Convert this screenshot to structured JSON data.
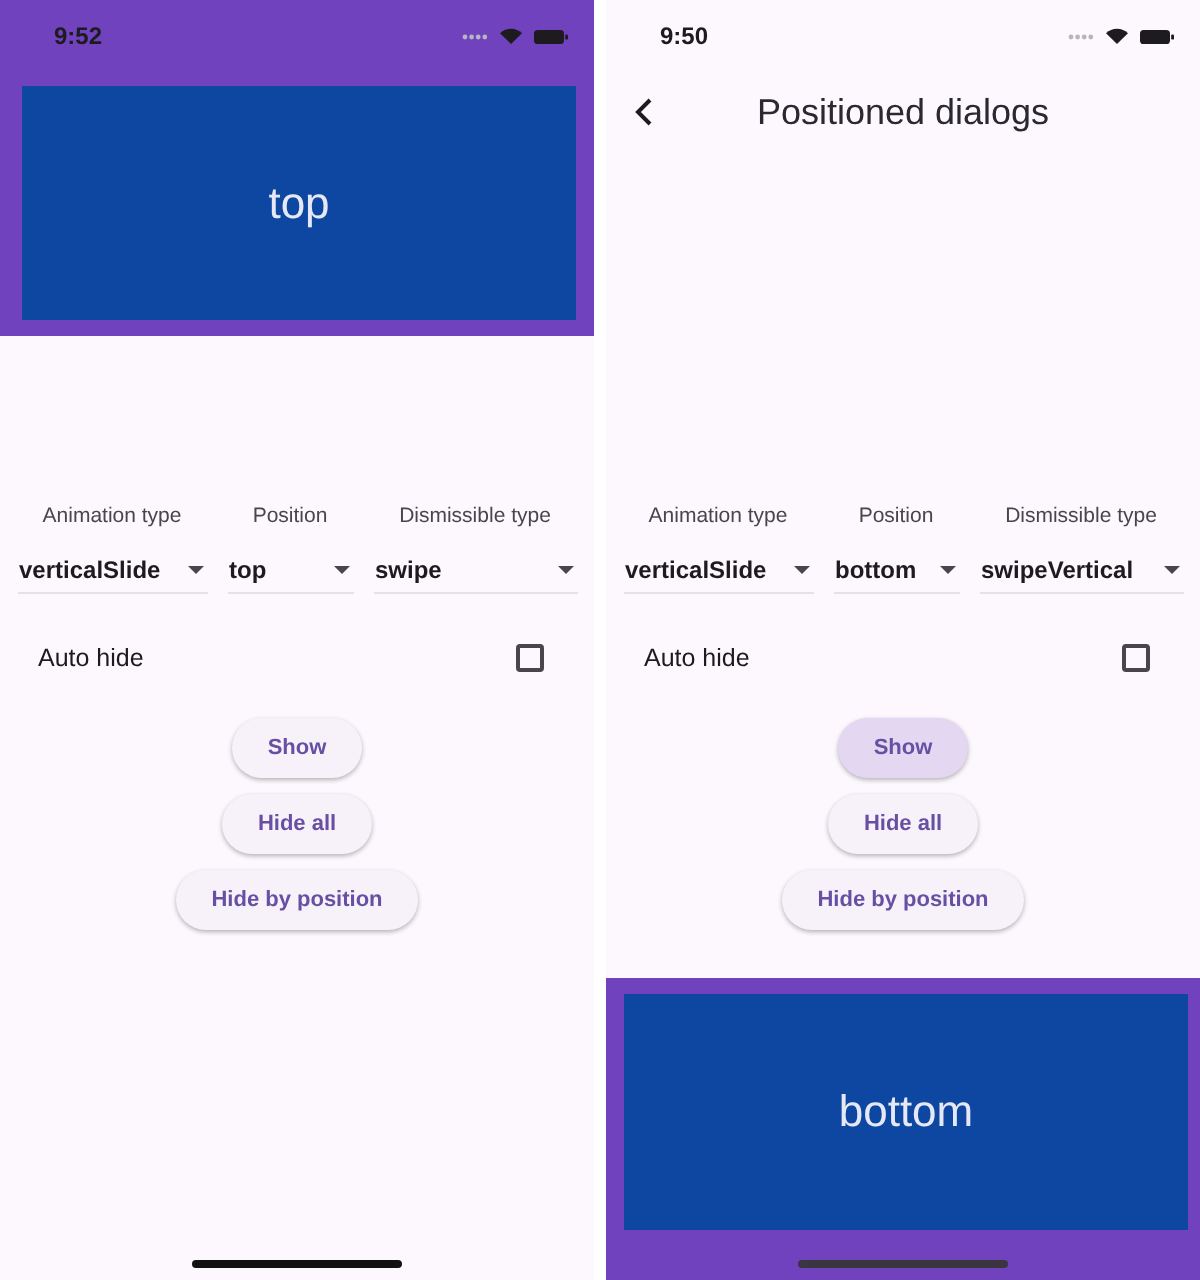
{
  "screens": [
    {
      "status_bar": {
        "time": "9:52"
      },
      "dialog": {
        "kind": "top",
        "text": "top"
      },
      "form": {
        "dropdowns": [
          {
            "label": "Animation type",
            "value": "verticalSlide"
          },
          {
            "label": "Position",
            "value": "top"
          },
          {
            "label": "Dismissible type",
            "value": "swipe"
          }
        ],
        "auto_hide": {
          "label": "Auto hide",
          "checked": false
        }
      },
      "buttons": [
        {
          "label": "Show",
          "pressed": false
        },
        {
          "label": "Hide all",
          "pressed": false
        },
        {
          "label": "Hide by position",
          "pressed": false
        }
      ]
    },
    {
      "status_bar": {
        "time": "9:50"
      },
      "app_bar": {
        "title": "Positioned dialogs"
      },
      "dialog": {
        "kind": "bottom",
        "text": "bottom"
      },
      "form": {
        "dropdowns": [
          {
            "label": "Animation type",
            "value": "verticalSlide"
          },
          {
            "label": "Position",
            "value": "bottom"
          },
          {
            "label": "Dismissible type",
            "value": "swipeVertical"
          }
        ],
        "auto_hide": {
          "label": "Auto hide",
          "checked": false
        }
      },
      "buttons": [
        {
          "label": "Show",
          "pressed": true
        },
        {
          "label": "Hide all",
          "pressed": false
        },
        {
          "label": "Hide by position",
          "pressed": false
        }
      ]
    }
  ]
}
